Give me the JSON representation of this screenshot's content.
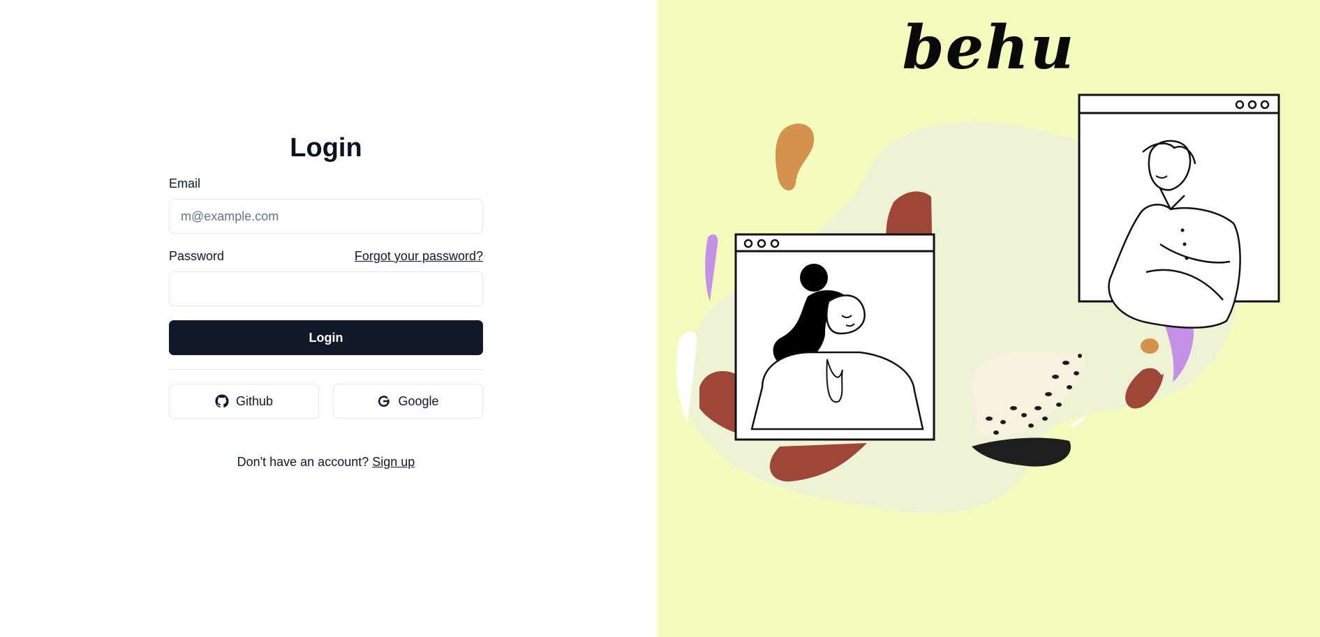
{
  "login_form": {
    "title": "Login",
    "email_label": "Email",
    "email_placeholder": "m@example.com",
    "email_value": "",
    "password_label": "Password",
    "password_value": "",
    "forgot_link": "Forgot your password?",
    "submit_label": "Login",
    "oauth": {
      "github_label": "Github",
      "github_icon": "github-icon",
      "google_label": "Google",
      "google_icon": "google-icon"
    },
    "signup_prompt": "Don't have an account?",
    "signup_link": "Sign up"
  },
  "brand": {
    "logo_text": "behu"
  },
  "colors": {
    "primary_button": "#111827",
    "illustration_background": "#f3fbbd",
    "accent_red": "#9e4638",
    "accent_orange": "#d4924f",
    "accent_purple": "#c591e6"
  }
}
